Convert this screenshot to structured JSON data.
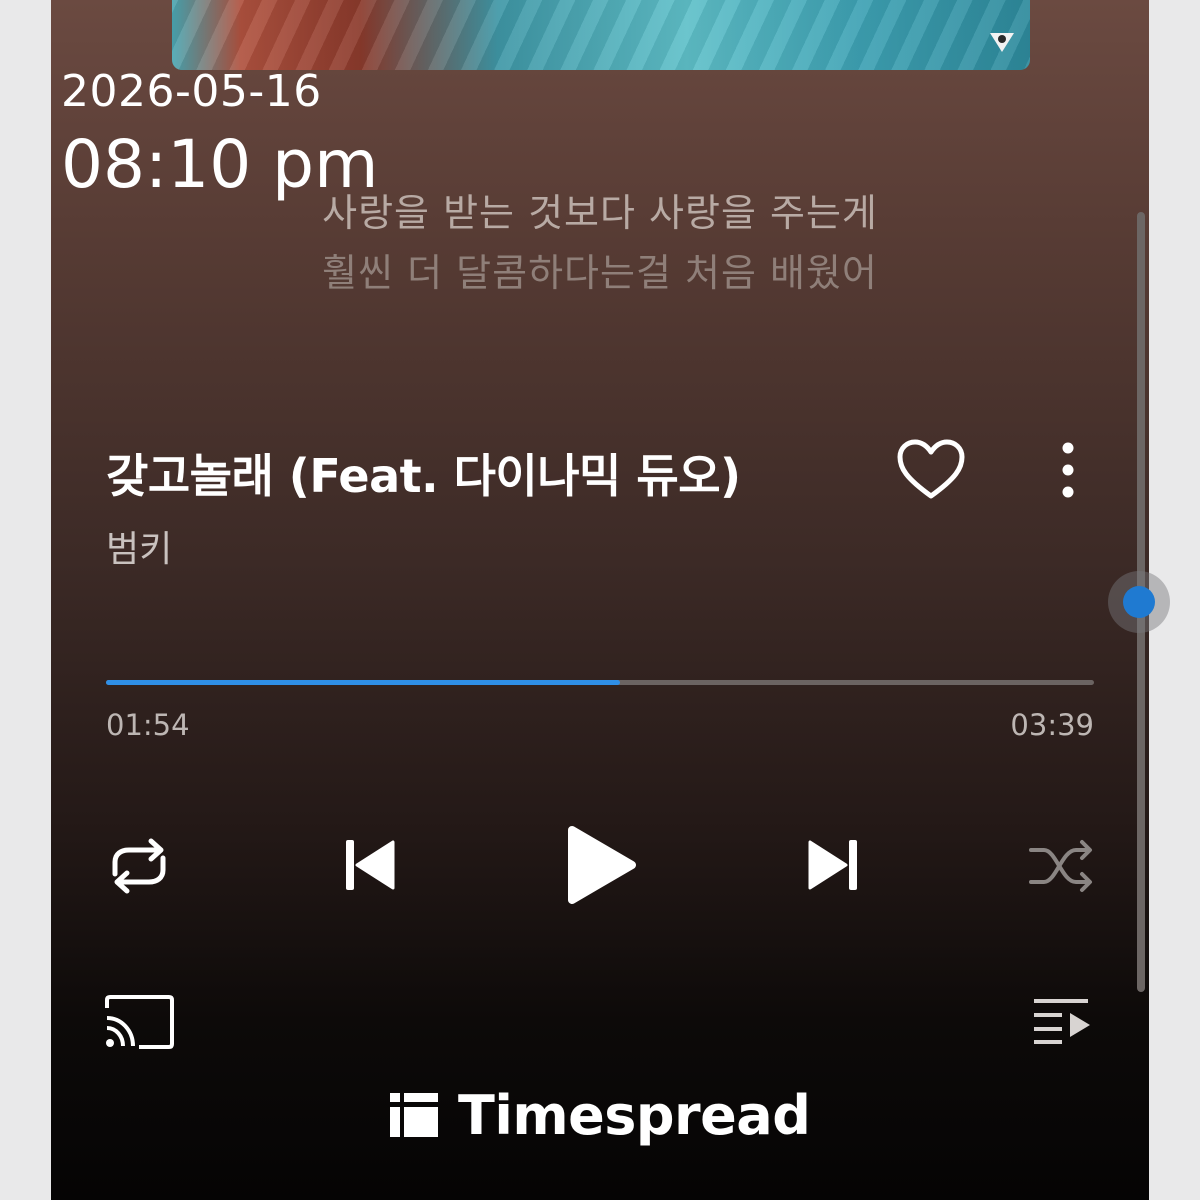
{
  "overlay": {
    "date": "2026-05-16",
    "time": "08:10 pm"
  },
  "lyrics": {
    "current_line": "사랑을 받는 것보다 사랑을 주는게",
    "next_line": "훨씬 더 달콤하다는걸 처음 배웠어"
  },
  "track": {
    "title": "갖고놀래 (Feat. 다이나믹 듀오)",
    "artist": "범키"
  },
  "playback": {
    "elapsed": "01:54",
    "duration": "03:39",
    "progress_fraction": 0.52,
    "state": "paused"
  },
  "controls": {
    "repeat_icon": "repeat-icon",
    "previous_icon": "skip-previous-icon",
    "play_icon": "play-icon",
    "next_icon": "skip-next-icon",
    "shuffle_icon": "shuffle-icon",
    "cast_icon": "cast-icon",
    "queue_icon": "queue-icon",
    "like_icon": "heart-outline-icon",
    "more_icon": "more-vertical-icon"
  },
  "watermark": {
    "brand": "Timespread"
  },
  "colors": {
    "accent": "#2f8fe6",
    "track_inactive": "#6b6462",
    "text_primary": "#ffffff",
    "text_secondary": "#bdb6b3"
  }
}
